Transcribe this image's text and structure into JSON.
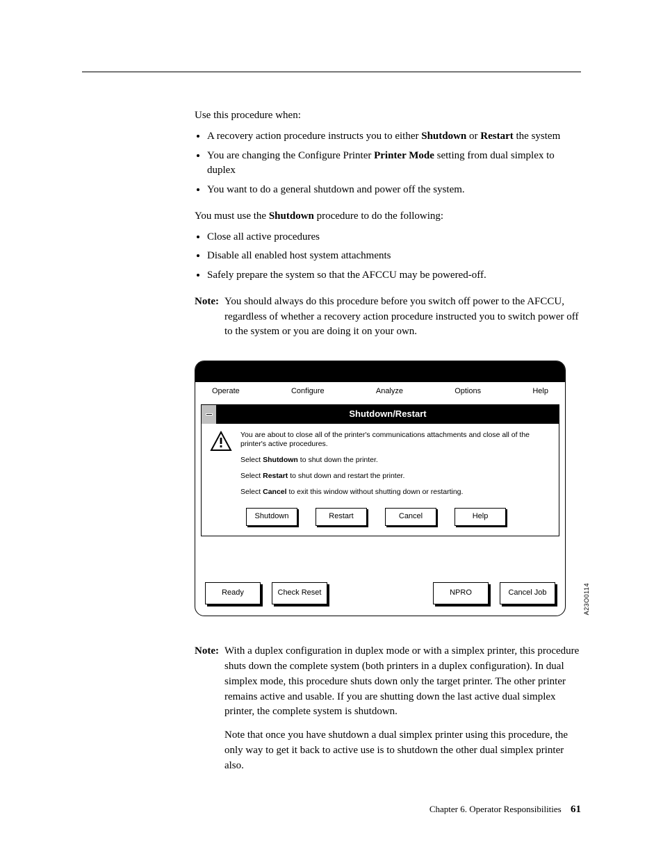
{
  "intro": "Use this procedure when:",
  "bullets1": [
    {
      "pre": "A recovery action procedure instructs you to either ",
      "b1": "Shutdown",
      "mid": " or ",
      "b2": "Restart",
      "post": " the system"
    },
    {
      "pre": "You are changing the Configure Printer ",
      "b1": "Printer Mode",
      "mid": "",
      "b2": "",
      "post": " setting from dual simplex to duplex"
    },
    {
      "pre": "You want to do a general shutdown and power off the system.",
      "b1": "",
      "mid": "",
      "b2": "",
      "post": ""
    }
  ],
  "mustuse_pre": "You must use the ",
  "mustuse_b": "Shutdown",
  "mustuse_post": " procedure to do the following:",
  "bullets2": [
    "Close all active procedures",
    "Disable all enabled host system attachments",
    "Safely prepare the system so that the AFCCU may be powered-off."
  ],
  "note1_label": "Note:",
  "note1_body": "You should always do this procedure before you switch off power to the AFCCU, regardless of whether a recovery action procedure instructed you to switch power off to the system or you are doing it on your own.",
  "dialog": {
    "menubar": [
      "Operate",
      "Configure",
      "Analyze",
      "Options",
      "Help"
    ],
    "title": "Shutdown/Restart",
    "msg1": "You are about to close all of the printer's communications attachments and close all of the printer's active procedures.",
    "msg2_pre": "Select ",
    "msg2_b": "Shutdown",
    "msg2_post": " to shut down the printer.",
    "msg3_pre": "Select ",
    "msg3_b": "Restart",
    "msg3_post": " to shut down and restart the printer.",
    "msg4_pre": "Select ",
    "msg4_b": "Cancel",
    "msg4_post": " to exit this window without shutting down or restarting.",
    "btns": [
      "Shutdown",
      "Restart",
      "Cancel",
      "Help"
    ],
    "bottom_btns": [
      "Ready",
      "Check Reset",
      "NPRO",
      "Cancel Job"
    ],
    "figcode": "A23O0114"
  },
  "note2_label": "Note:",
  "note2_p1": "With a duplex configuration in duplex mode or with a simplex printer, this procedure shuts down the complete system (both printers in a duplex configuration). In dual simplex mode, this procedure shuts down only the target printer. The other printer remains active and usable. If you are shutting down the last active dual simplex printer, the complete system is shutdown.",
  "note2_p2": "Note that once you have shutdown a dual simplex printer using this procedure, the only way to get it back to active use is to shutdown the other dual simplex printer also.",
  "footer_chapter": "Chapter 6. Operator Responsibilities",
  "footer_page": "61"
}
